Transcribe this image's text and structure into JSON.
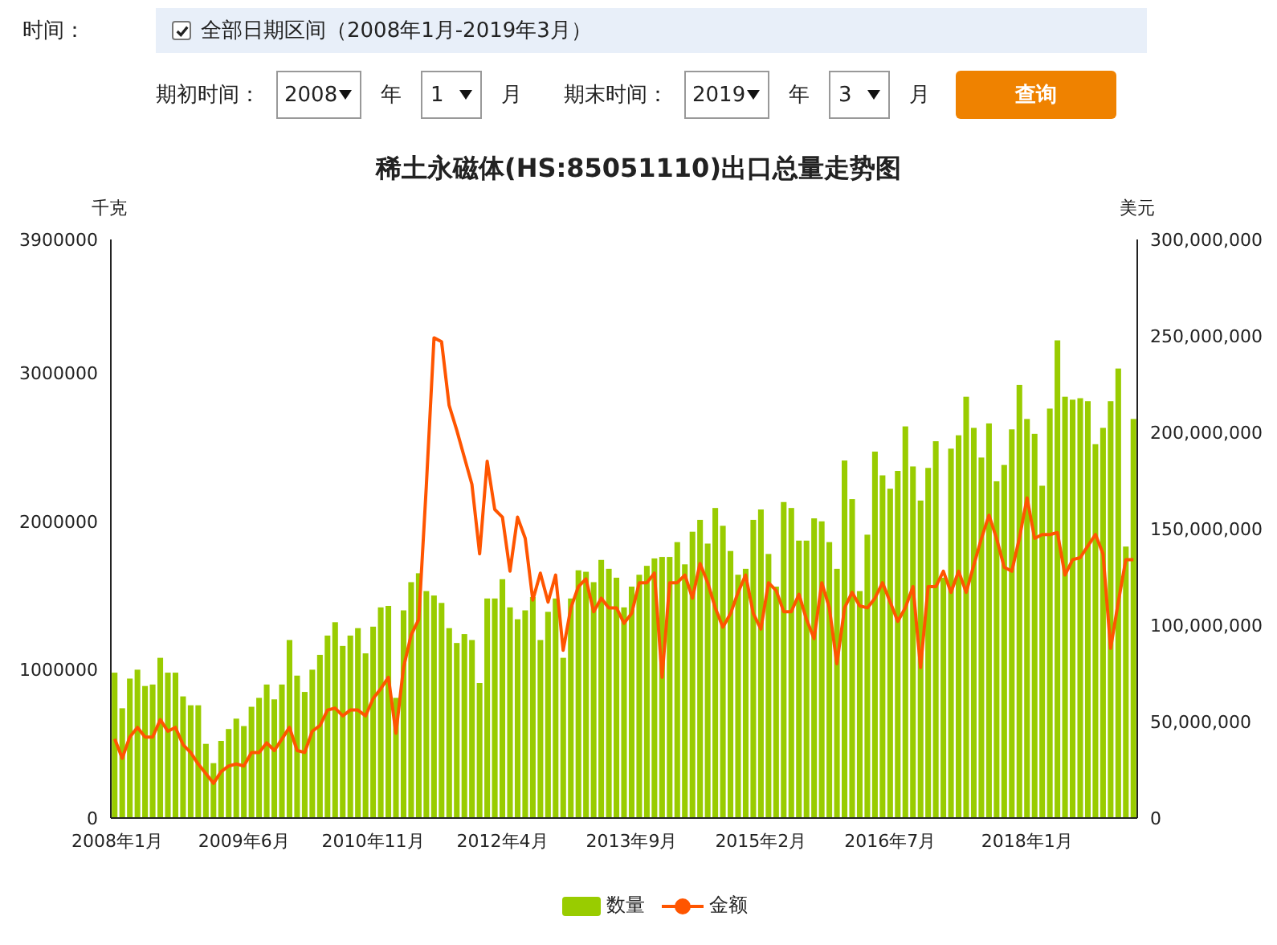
{
  "filter": {
    "label": "时间：",
    "all_range": {
      "checked": true,
      "text": "全部日期区间（2008年1月-2019年3月）"
    },
    "start": {
      "label": "期初时间：",
      "year": "2008",
      "year_unit": "年",
      "month": "1",
      "month_unit": "月"
    },
    "end": {
      "label": "期末时间：",
      "year": "2019",
      "year_unit": "年",
      "month": "3",
      "month_unit": "月"
    },
    "query_button": "查询"
  },
  "chart": {
    "chart_data": {
      "type": "bar",
      "title": "稀土永磁体(HS:85051110)出口总量走势图",
      "ylabel": "千克",
      "y2label": "美元",
      "categories": [
        "2008年1月",
        null,
        null,
        null,
        null,
        null,
        null,
        null,
        null,
        null,
        null,
        null,
        null,
        null,
        null,
        null,
        null,
        "2009年6月",
        null,
        null,
        null,
        null,
        null,
        null,
        null,
        null,
        null,
        null,
        null,
        null,
        null,
        null,
        null,
        null,
        "2010年11月",
        null,
        null,
        null,
        null,
        null,
        null,
        null,
        null,
        null,
        null,
        null,
        null,
        null,
        null,
        null,
        null,
        "2012年4月",
        null,
        null,
        null,
        null,
        null,
        null,
        null,
        null,
        null,
        null,
        null,
        null,
        null,
        null,
        null,
        null,
        "2013年9月",
        null,
        null,
        null,
        null,
        null,
        null,
        null,
        null,
        null,
        null,
        null,
        null,
        null,
        null,
        null,
        null,
        "2015年2月",
        null,
        null,
        null,
        null,
        null,
        null,
        null,
        null,
        null,
        null,
        null,
        null,
        null,
        null,
        null,
        null,
        "2016年7月",
        null,
        null,
        null,
        null,
        null,
        null,
        null,
        null,
        null,
        null,
        null,
        null,
        null,
        null,
        null,
        null,
        null,
        "2018年1月",
        null,
        null,
        null,
        null,
        null,
        null,
        null,
        null,
        null,
        null,
        null,
        null,
        null,
        null
      ],
      "ylim": [
        0,
        3900000
      ],
      "yticks": [
        0,
        1000000,
        2000000,
        3000000,
        3900000
      ],
      "y2lim": [
        0,
        300000000
      ],
      "y2ticks": [
        {
          "value": 0,
          "label": "0"
        },
        {
          "value": 50000000,
          "label": "50,000,000"
        },
        {
          "value": 100000000,
          "label": "100,000,000"
        },
        {
          "value": 150000000,
          "label": "150,000,000"
        },
        {
          "value": 200000000,
          "label": "200,000,000"
        },
        {
          "value": 250000000,
          "label": "250,000,000"
        },
        {
          "value": 300000000,
          "label": "300,000,000"
        }
      ],
      "series": [
        {
          "name": "数量",
          "type": "bar",
          "axis": "y",
          "color": "#99cc00",
          "values": [
            980000,
            740000,
            940000,
            1000000,
            890000,
            900000,
            1080000,
            980000,
            980000,
            820000,
            760000,
            760000,
            500000,
            370000,
            520000,
            600000,
            670000,
            620000,
            750000,
            810000,
            900000,
            800000,
            900000,
            1200000,
            960000,
            850000,
            1000000,
            1100000,
            1230000,
            1320000,
            1160000,
            1230000,
            1280000,
            1110000,
            1290000,
            1420000,
            1430000,
            810000,
            1400000,
            1590000,
            1650000,
            1530000,
            1500000,
            1450000,
            1280000,
            1180000,
            1240000,
            1200000,
            910000,
            1480000,
            1480000,
            1610000,
            1420000,
            1340000,
            1400000,
            1490000,
            1200000,
            1390000,
            1480000,
            1080000,
            1480000,
            1670000,
            1660000,
            1590000,
            1740000,
            1680000,
            1620000,
            1420000,
            1560000,
            1640000,
            1700000,
            1750000,
            1760000,
            1760000,
            1860000,
            1710000,
            1930000,
            2010000,
            1850000,
            2090000,
            1970000,
            1800000,
            1640000,
            1680000,
            2010000,
            2080000,
            1780000,
            1560000,
            2130000,
            2090000,
            1870000,
            1870000,
            2020000,
            2000000,
            1860000,
            1680000,
            2410000,
            2150000,
            1530000,
            1910000,
            2470000,
            2310000,
            2220000,
            2340000,
            2640000,
            2370000,
            2140000,
            2360000,
            2540000,
            1620000,
            2490000,
            2580000,
            2840000,
            2630000,
            2430000,
            2660000,
            2270000,
            2380000,
            2620000,
            2920000,
            2690000,
            2590000,
            2240000,
            2760000,
            3220000,
            2840000,
            2820000,
            2830000,
            2810000,
            2520000,
            2630000,
            2810000,
            3030000,
            1830000,
            2690000
          ]
        },
        {
          "name": "金额",
          "type": "line",
          "axis": "y2",
          "color": "#ff5500",
          "values": [
            41000000,
            31000000,
            42000000,
            47000000,
            42000000,
            42000000,
            51000000,
            45000000,
            47000000,
            38000000,
            34000000,
            28000000,
            23000000,
            18000000,
            24000000,
            27000000,
            28000000,
            27000000,
            34000000,
            34000000,
            39000000,
            35000000,
            41000000,
            47000000,
            35000000,
            34000000,
            45000000,
            48000000,
            56000000,
            57000000,
            53000000,
            56000000,
            56000000,
            53000000,
            62000000,
            67000000,
            73000000,
            44000000,
            78000000,
            95000000,
            103000000,
            172000000,
            249000000,
            247000000,
            214000000,
            201000000,
            187000000,
            173000000,
            137000000,
            185000000,
            160000000,
            156000000,
            128000000,
            156000000,
            145000000,
            113000000,
            127000000,
            112000000,
            126000000,
            87000000,
            109000000,
            120000000,
            124000000,
            107000000,
            114000000,
            109000000,
            109000000,
            101000000,
            106000000,
            122000000,
            122000000,
            127000000,
            73000000,
            122000000,
            122000000,
            126000000,
            114000000,
            132000000,
            122000000,
            109000000,
            99000000,
            106000000,
            117000000,
            126000000,
            106000000,
            98000000,
            122000000,
            118000000,
            107000000,
            107000000,
            116000000,
            103000000,
            93000000,
            122000000,
            109000000,
            80000000,
            109000000,
            117000000,
            110000000,
            109000000,
            114000000,
            122000000,
            112000000,
            102000000,
            109000000,
            120000000,
            78000000,
            120000000,
            120000000,
            128000000,
            117000000,
            128000000,
            117000000,
            131000000,
            145000000,
            157000000,
            145000000,
            130000000,
            128000000,
            145000000,
            166000000,
            145000000,
            147000000,
            147000000,
            148000000,
            126000000,
            134000000,
            135000000,
            141000000,
            147000000,
            137000000,
            88000000,
            112000000,
            134000000,
            134000000
          ]
        }
      ]
    }
  }
}
